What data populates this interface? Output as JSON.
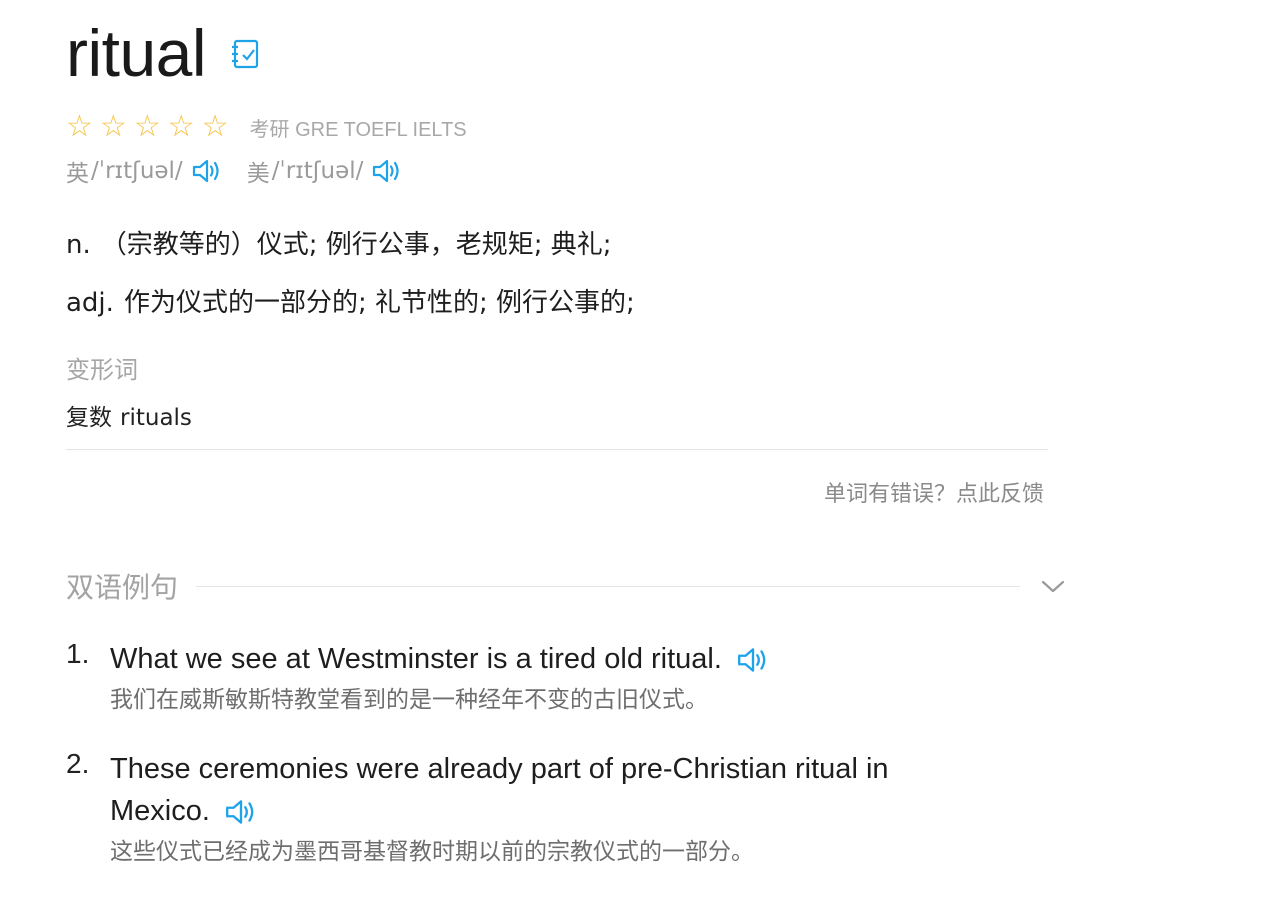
{
  "word": "ritual",
  "rating": {
    "stars_total": 5,
    "stars_filled": 0,
    "exam_tags": "考研 GRE TOEFL IELTS"
  },
  "phonetics": [
    {
      "region": "英",
      "ipa": "/ˈrɪtʃuəl/"
    },
    {
      "region": "美",
      "ipa": "/ˈrɪtʃuəl/"
    }
  ],
  "definitions": [
    {
      "pos": "n.",
      "meaning": "（宗教等的）仪式; 例行公事，老规矩; 典礼;"
    },
    {
      "pos": "adj.",
      "meaning": "作为仪式的一部分的; 礼节性的; 例行公事的;"
    }
  ],
  "inflections": {
    "label": "变形词",
    "items": [
      {
        "label": "复数",
        "value": "rituals"
      }
    ]
  },
  "feedback_link": "单词有错误？点此反馈",
  "examples_section": {
    "title": "双语例句",
    "items": [
      {
        "num": "1.",
        "en": "What we see at Westminster is a tired old ritual.",
        "zh": "我们在威斯敏斯特教堂看到的是一种经年不变的古旧仪式。"
      },
      {
        "num": "2.",
        "en": "These ceremonies were already part of pre-Christian ritual in Mexico.",
        "zh": "这些仪式已经成为墨西哥基督教时期以前的宗教仪式的一部分。"
      }
    ]
  },
  "colors": {
    "accent": "#1fa3e8",
    "star": "#f5c242",
    "muted": "#a6a6a6"
  },
  "icons": {
    "wordbook": "notebook-check-icon",
    "audio": "speaker-icon",
    "collapse": "chevron-down-icon"
  }
}
